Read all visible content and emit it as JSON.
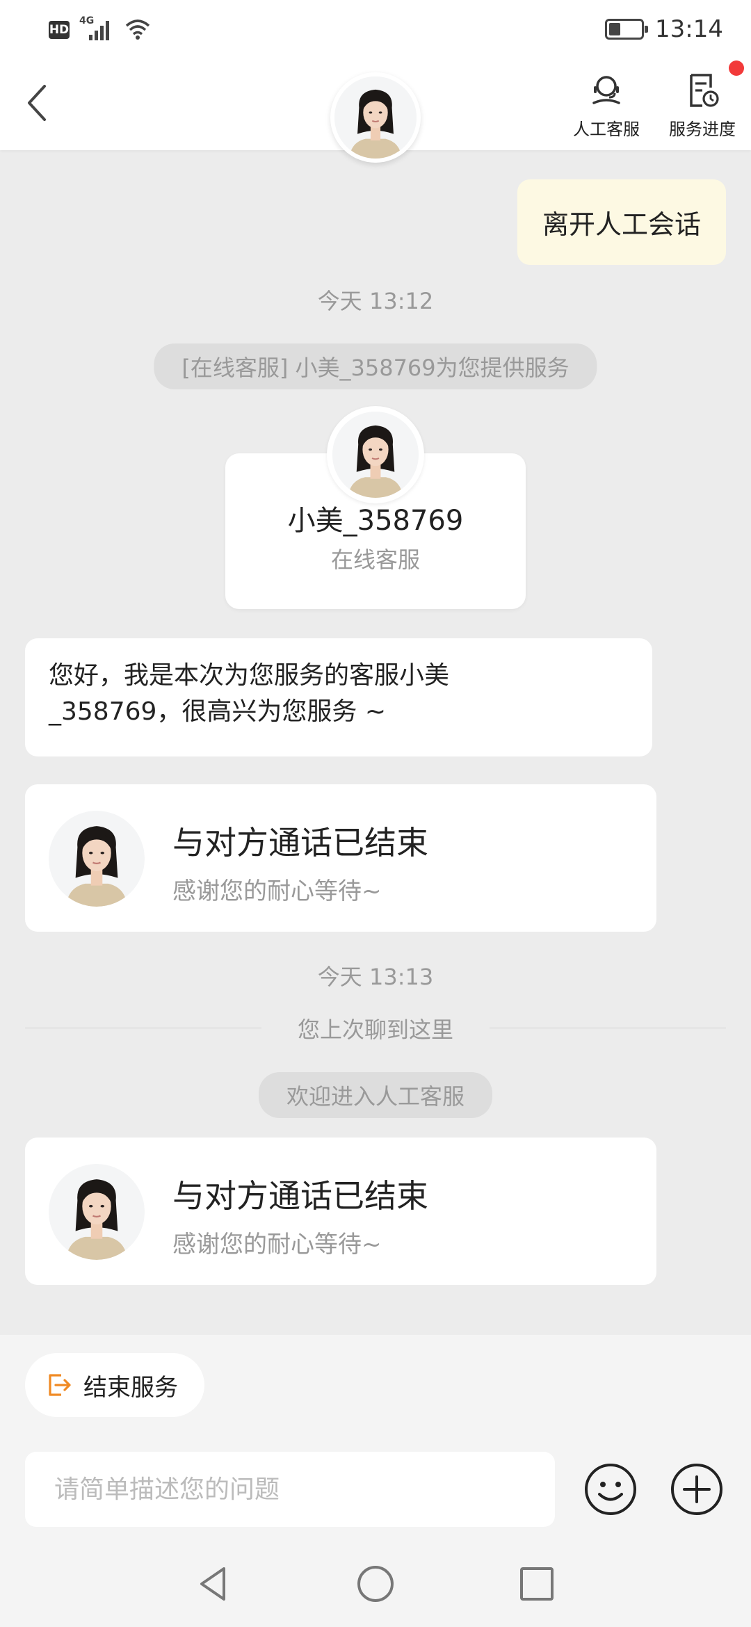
{
  "status_bar": {
    "hd": "HD",
    "network": "4G",
    "time": "13:14"
  },
  "header": {
    "support_label": "人工客服",
    "progress_label": "服务进度",
    "accent_color": "#f23a3a"
  },
  "chat": {
    "user_message": "离开人工会话",
    "time_1": "今天 13:12",
    "system_notice": "[在线客服] 小美_358769为您提供服务",
    "agent_card": {
      "name": "小美_358769",
      "role": "在线客服"
    },
    "greeting_line_1": "您好，我是本次为您服务的客服小美",
    "greeting_line_2": "_358769，很高兴为您服务 ~",
    "end_card_1": {
      "title": "与对方通话已结束",
      "subtitle": "感谢您的耐心等待~"
    },
    "time_2": "今天 13:13",
    "last_read_divider": "您上次聊到这里",
    "welcome_notice": "欢迎进入人工客服",
    "end_card_2": {
      "title": "与对方通话已结束",
      "subtitle": "感谢您的耐心等待~"
    }
  },
  "bottom": {
    "end_service_label": "结束服务",
    "input_placeholder": "请简单描述您的问题",
    "input_value": ""
  },
  "icons": {
    "back": "back-arrow-icon",
    "support": "headset-icon",
    "progress": "document-clock-icon",
    "end_service": "exit-icon",
    "emoji": "smiley-icon",
    "plus": "plus-circle-icon"
  }
}
